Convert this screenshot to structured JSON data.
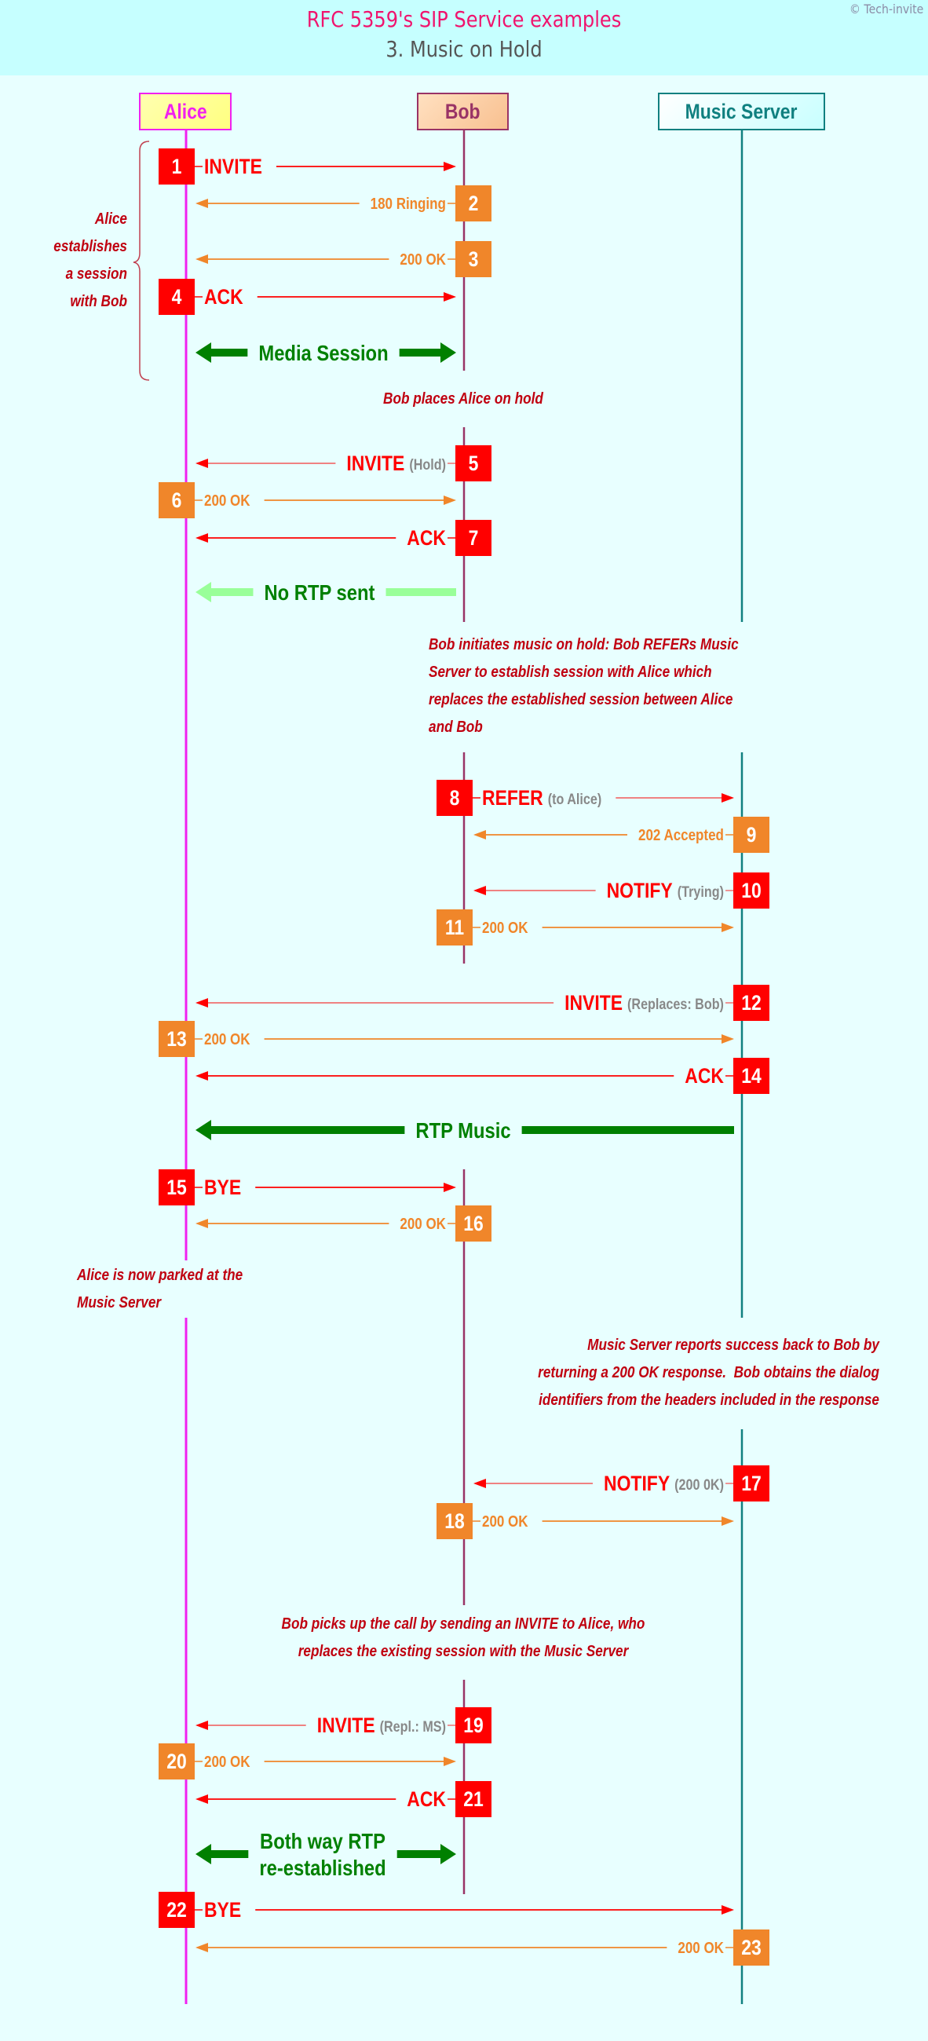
{
  "header": {
    "title": "RFC 5359's SIP Service examples",
    "subtitle": "3. Music on Hold",
    "copyright": "© Tech-invite"
  },
  "colors": {
    "request": "#ff0000",
    "response": "#f0862a",
    "param": "#888888",
    "media": "#008000",
    "media_inactive": "#99ff99",
    "note": "#c00010",
    "alice": "#f020f0",
    "bob": "#993366",
    "music_server": "#108080"
  },
  "actors": [
    {
      "id": "alice",
      "label": "Alice"
    },
    {
      "id": "bob",
      "label": "Bob"
    },
    {
      "id": "ms",
      "label": "Music Server"
    }
  ],
  "messages": [
    {
      "step": "1",
      "from": "alice",
      "to": "bob",
      "kind": "request",
      "label": "INVITE",
      "param": ""
    },
    {
      "step": "2",
      "from": "bob",
      "to": "alice",
      "kind": "response",
      "label": "180 Ringing",
      "param": ""
    },
    {
      "step": "3",
      "from": "bob",
      "to": "alice",
      "kind": "response",
      "label": "200 OK",
      "param": ""
    },
    {
      "step": "4",
      "from": "alice",
      "to": "bob",
      "kind": "request",
      "label": "ACK",
      "param": ""
    },
    {
      "step": "5",
      "from": "bob",
      "to": "alice",
      "kind": "request",
      "label": "INVITE",
      "param": "(Hold)"
    },
    {
      "step": "6",
      "from": "alice",
      "to": "bob",
      "kind": "response",
      "label": "200 OK",
      "param": ""
    },
    {
      "step": "7",
      "from": "bob",
      "to": "alice",
      "kind": "request",
      "label": "ACK",
      "param": ""
    },
    {
      "step": "8",
      "from": "bob",
      "to": "ms",
      "kind": "request",
      "label": "REFER",
      "param": "(to Alice)"
    },
    {
      "step": "9",
      "from": "ms",
      "to": "bob",
      "kind": "response",
      "label": "202 Accepted",
      "param": ""
    },
    {
      "step": "10",
      "from": "ms",
      "to": "bob",
      "kind": "request",
      "label": "NOTIFY",
      "param": "(Trying)"
    },
    {
      "step": "11",
      "from": "bob",
      "to": "ms",
      "kind": "response",
      "label": "200 OK",
      "param": ""
    },
    {
      "step": "12",
      "from": "ms",
      "to": "alice",
      "kind": "request",
      "label": "INVITE",
      "param": "(Replaces: Bob)"
    },
    {
      "step": "13",
      "from": "alice",
      "to": "ms",
      "kind": "response",
      "label": "200 OK",
      "param": ""
    },
    {
      "step": "14",
      "from": "ms",
      "to": "alice",
      "kind": "request",
      "label": "ACK",
      "param": ""
    },
    {
      "step": "15",
      "from": "alice",
      "to": "bob",
      "kind": "request",
      "label": "BYE",
      "param": ""
    },
    {
      "step": "16",
      "from": "bob",
      "to": "alice",
      "kind": "response",
      "label": "200 OK",
      "param": ""
    },
    {
      "step": "17",
      "from": "ms",
      "to": "bob",
      "kind": "request",
      "label": "NOTIFY",
      "param": "(200 0K)"
    },
    {
      "step": "18",
      "from": "bob",
      "to": "ms",
      "kind": "response",
      "label": "200 OK",
      "param": ""
    },
    {
      "step": "19",
      "from": "bob",
      "to": "alice",
      "kind": "request",
      "label": "INVITE",
      "param": "(Repl.: MS)"
    },
    {
      "step": "20",
      "from": "alice",
      "to": "bob",
      "kind": "response",
      "label": "200 OK",
      "param": ""
    },
    {
      "step": "21",
      "from": "bob",
      "to": "alice",
      "kind": "request",
      "label": "ACK",
      "param": ""
    },
    {
      "step": "22",
      "from": "alice",
      "to": "ms",
      "kind": "request",
      "label": "BYE",
      "param": ""
    },
    {
      "step": "23",
      "from": "ms",
      "to": "alice",
      "kind": "response",
      "label": "200 OK",
      "param": ""
    }
  ],
  "media": [
    {
      "from": "alice",
      "to": "bob",
      "direction": "both",
      "label": [
        "Media Session"
      ],
      "active": true
    },
    {
      "from": "bob",
      "to": "alice",
      "direction": "left",
      "label": [
        "No RTP sent"
      ],
      "active": false
    },
    {
      "from": "ms",
      "to": "alice",
      "direction": "left",
      "label": [
        "RTP Music"
      ],
      "active": true
    },
    {
      "from": "alice",
      "to": "bob",
      "direction": "both",
      "label": [
        "Both way RTP",
        "re-established"
      ],
      "active": true
    }
  ],
  "notes": {
    "alice_establishes": [
      "Alice",
      "establishes",
      "a session",
      "with Bob"
    ],
    "bob_places_hold": [
      "Bob places Alice on hold"
    ],
    "bob_initiates_moh": [
      "Bob initiates music on hold: Bob REFERs Music",
      "Server to establish session with Alice which",
      "replaces the established session between Alice",
      "and Bob"
    ],
    "alice_parked": [
      "Alice is now parked at the",
      "Music Server"
    ],
    "ms_reports_success": [
      "Music Server reports success back to Bob by",
      "returning a 200 OK response.  Bob obtains the dialog",
      "identifiers from the headers included in the response"
    ],
    "bob_picks_up": [
      "Bob picks up the call by sending an INVITE to Alice, who",
      "replaces the existing session with the Music Server"
    ]
  }
}
